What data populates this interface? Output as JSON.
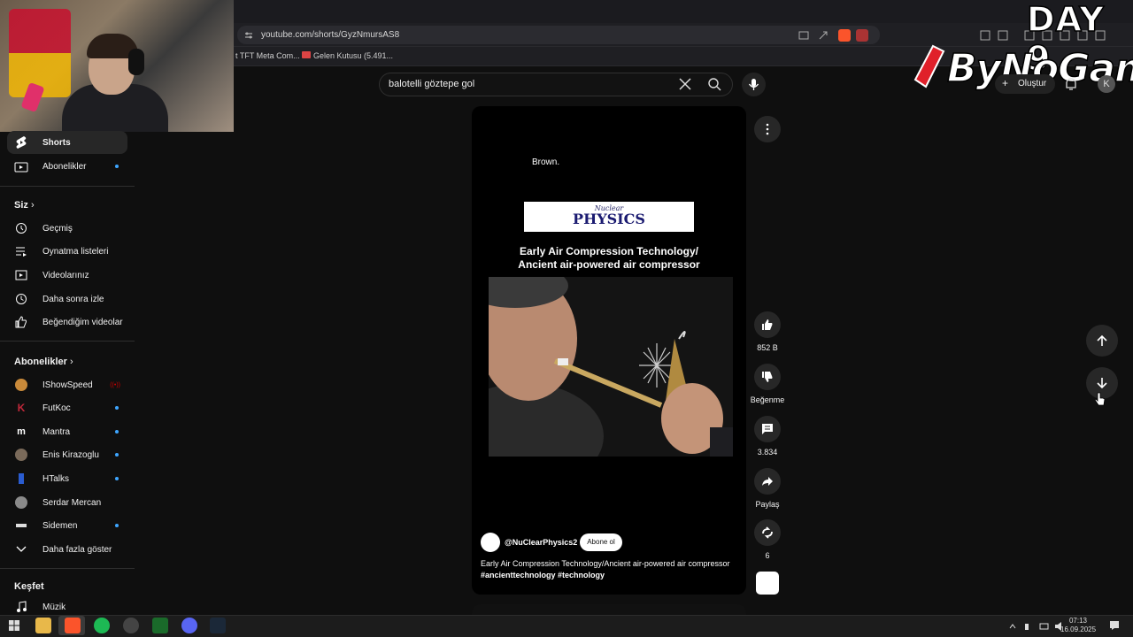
{
  "browser": {
    "url": "youtube.com/shorts/GyzNmursAS8",
    "bookmarks": [
      "t TFT Meta Com...",
      "Gelen Kutusu (5.491..."
    ]
  },
  "overlay": {
    "day": "DAY 9",
    "brand": "ByNoGame"
  },
  "header": {
    "search_value": "balotelli göztepe gol",
    "create_label": "Oluştur",
    "avatar_letter": "K"
  },
  "sidebar": {
    "top_items": [
      {
        "label": "Shorts",
        "icon": "shorts-icon",
        "active": true
      },
      {
        "label": "Abonelikler",
        "icon": "subscriptions-icon",
        "dot": true
      }
    ],
    "you_header": "Siz",
    "you_items": [
      {
        "label": "Geçmiş",
        "icon": "history-icon"
      },
      {
        "label": "Oynatma listeleri",
        "icon": "playlists-icon"
      },
      {
        "label": "Videolarınız",
        "icon": "your-videos-icon"
      },
      {
        "label": "Daha sonra izle",
        "icon": "watch-later-icon"
      },
      {
        "label": "Beğendiğim videolar",
        "icon": "liked-videos-icon"
      }
    ],
    "subs_header": "Abonelikler",
    "subs": [
      {
        "label": "IShowSpeed",
        "color": "#c98a3a",
        "live": true
      },
      {
        "label": "FutKoc",
        "color": "#c0283a",
        "dot": true
      },
      {
        "label": "Mantra",
        "color": "#ffffff",
        "dot": true
      },
      {
        "label": "Enis Kirazoglu",
        "color": "#7a6a5a",
        "dot": true
      },
      {
        "label": "HTalks",
        "color": "#2a5cd0",
        "dot": true
      },
      {
        "label": "Serdar Mercan",
        "color": "#8a8a8a",
        "dot": false
      },
      {
        "label": "Sidemen",
        "color": "#dddddd",
        "dot": true
      }
    ],
    "show_more": "Daha fazla göster",
    "explore_header": "Keşfet",
    "explore_items": [
      {
        "label": "Müzik",
        "icon": "music-icon"
      }
    ]
  },
  "short": {
    "caption_word": "Brown.",
    "logo_line1": "Nuclear",
    "logo_line2": "PHYSICS",
    "title_line1": "Early Air Compression Technology/",
    "title_line2": "Ancient air-powered air compressor",
    "channel": "@NuClearPhysics2",
    "subscribe_label": "Abone ol",
    "description": "Early Air Compression Technology/Ancient air-powered air compressor",
    "hashtags": "#ancienttechnology #technology"
  },
  "actions": {
    "likes": "852 B",
    "dislike_label": "Beğenme",
    "comments": "3.834",
    "share_label": "Paylaş",
    "remix_count": "6"
  },
  "taskbar": {
    "time": "07:13",
    "date": "16.09.2025"
  },
  "colors": {
    "background": "#0f0f0f",
    "accent": "#3ea6ff",
    "button_bg": "#272727"
  }
}
